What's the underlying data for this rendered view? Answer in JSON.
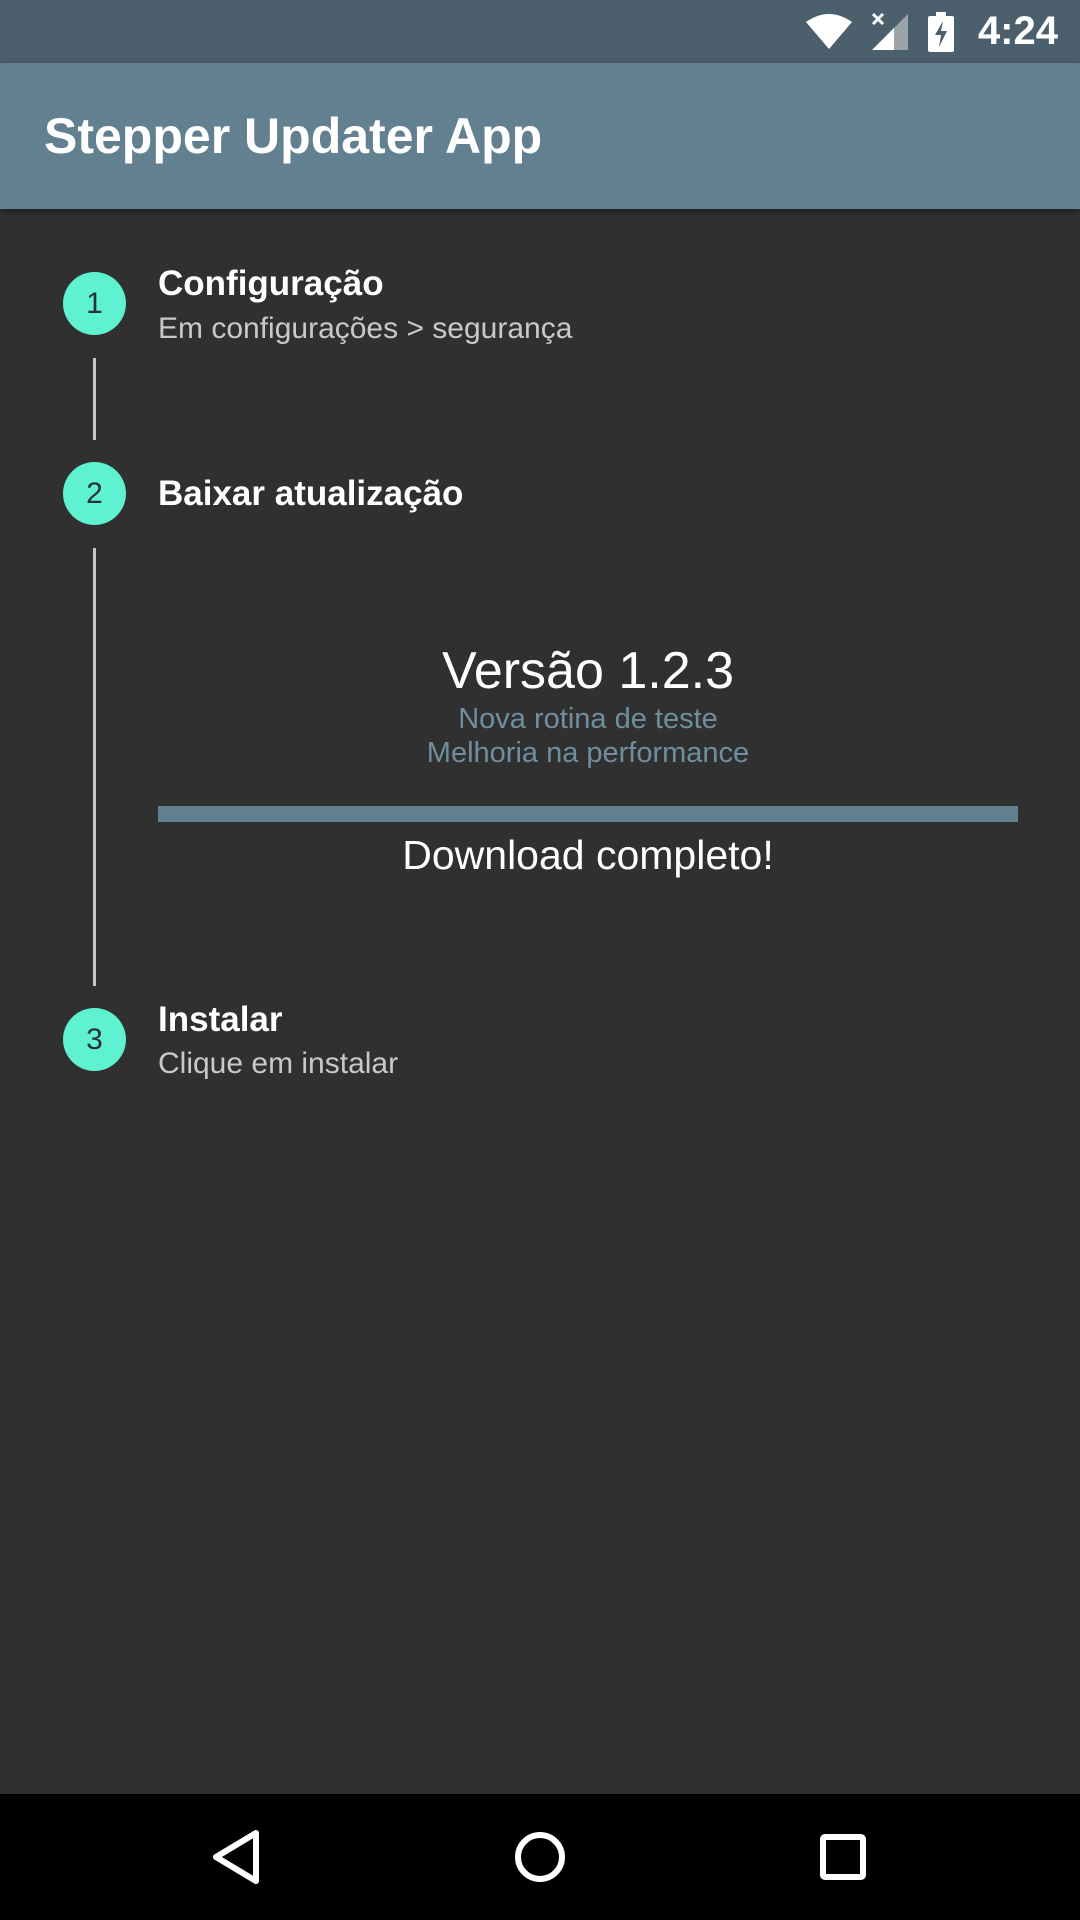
{
  "status_bar": {
    "time": "4:24",
    "icons": [
      "wifi-icon",
      "signal-icon",
      "battery-charging-icon"
    ]
  },
  "app_bar": {
    "title": "Stepper Updater App"
  },
  "steps": [
    {
      "number": "1",
      "title": "Configuração",
      "subtitle": "Em configurações > segurança"
    },
    {
      "number": "2",
      "title": "Baixar atualização",
      "subtitle": ""
    },
    {
      "number": "3",
      "title": "Instalar",
      "subtitle": "Clique em instalar"
    }
  ],
  "update": {
    "version": "Versão 1.2.3",
    "notes": [
      "Nova rotina de teste",
      "Melhoria na performance"
    ],
    "progress": 1.0,
    "status": "Download completo!"
  },
  "nav_bar": {
    "buttons": [
      "back-icon",
      "home-icon",
      "recents-icon"
    ]
  },
  "colors": {
    "status_bar": "#4b5f6c",
    "app_bar": "#62808f",
    "background": "#303030",
    "accent": "#5ef2d0",
    "secondary_text": "#6f8f9e"
  }
}
